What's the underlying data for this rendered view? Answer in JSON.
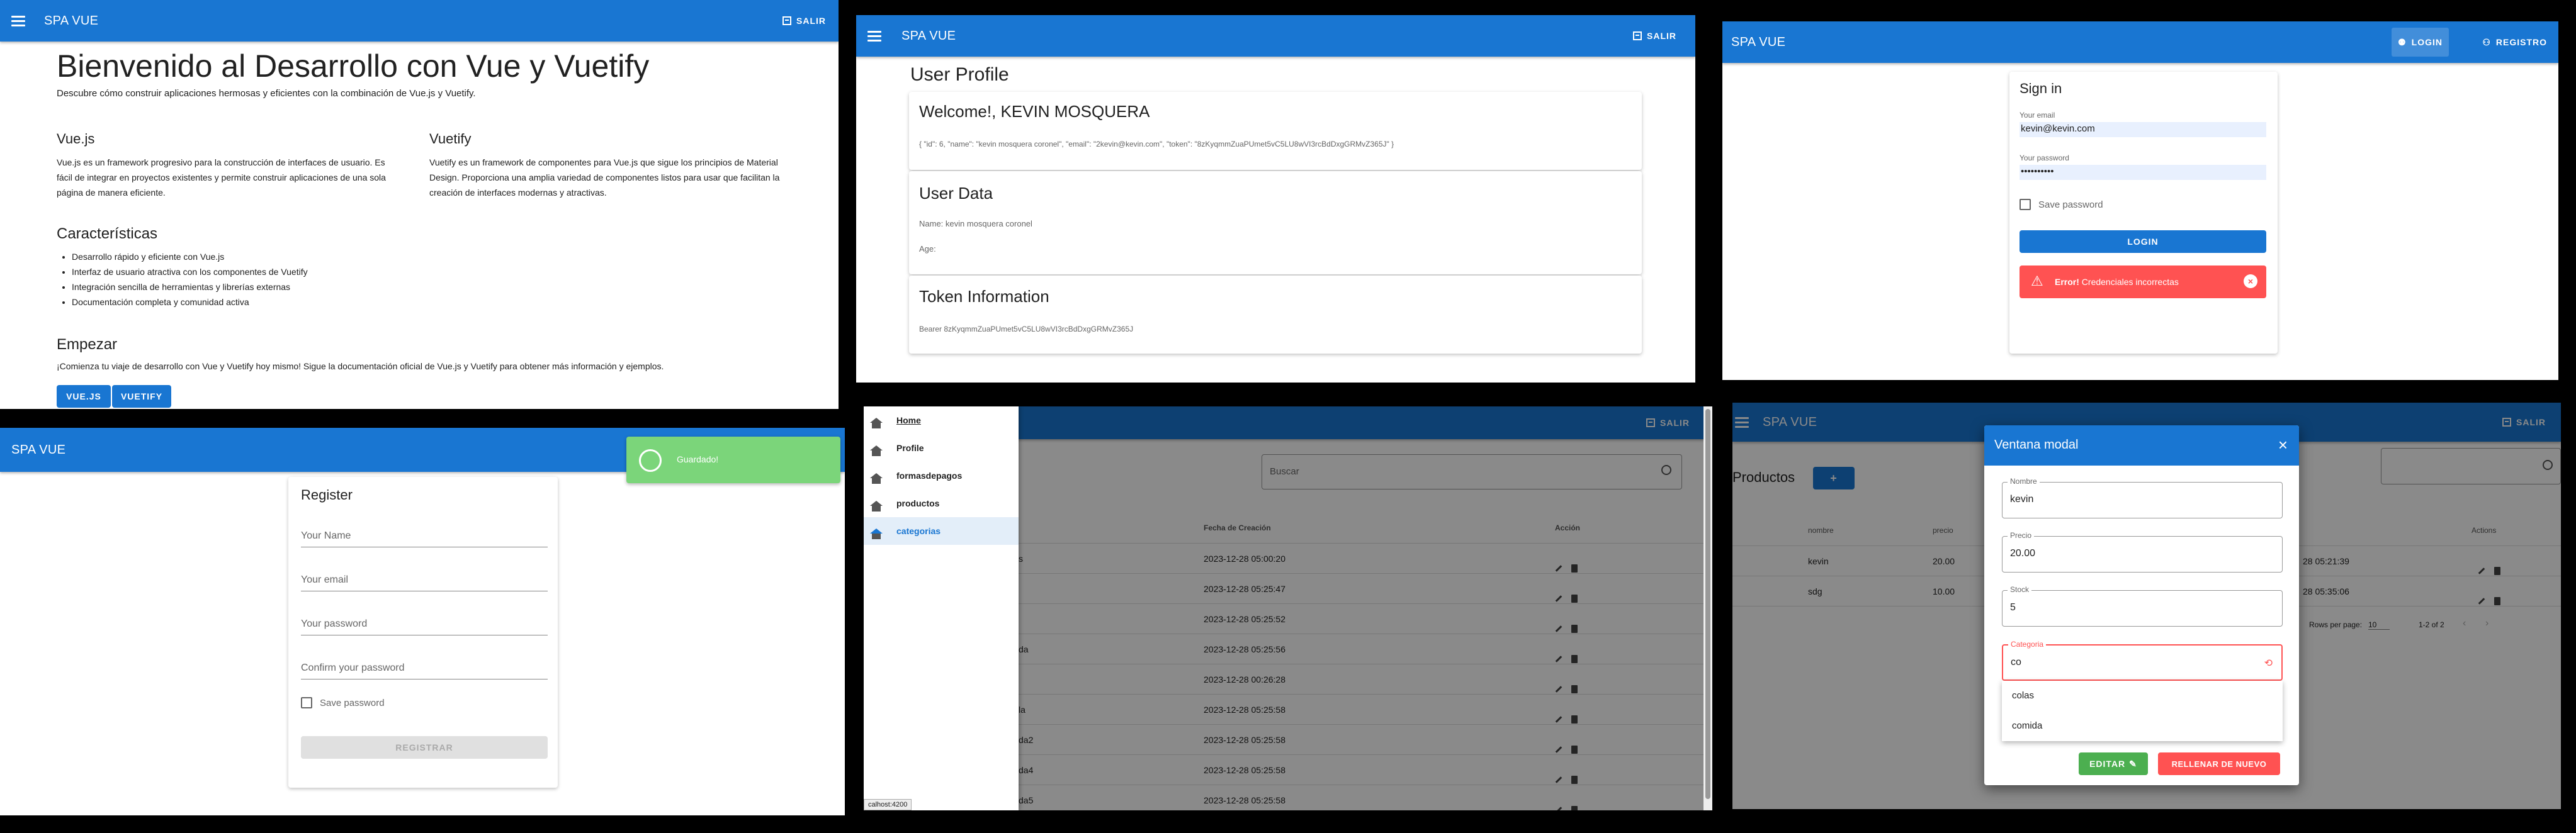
{
  "colors": {
    "primary": "#1976d2",
    "error": "#ff5252",
    "success": "#4caf50",
    "snackbar": "#7bd57a"
  },
  "p1": {
    "brand": "SPA VUE",
    "logout": "SALIR",
    "hero_title": "Bienvenido al Desarrollo con Vue y Vuetify",
    "hero_sub": "Descubre cómo construir aplicaciones hermosas y eficientes con la combinación de Vue.js y Vuetify.",
    "vue_title": "Vue.js",
    "vue_text": "Vue.js es un framework progresivo para la construcción de interfaces de usuario. Es fácil de integrar en proyectos existentes y permite construir aplicaciones de una sola página de manera eficiente.",
    "vuetify_title": "Vuetify",
    "vuetify_text": "Vuetify es un framework de componentes para Vue.js que sigue los principios de Material Design. Proporciona una amplia variedad de componentes listos para usar que facilitan la creación de interfaces modernas y atractivas.",
    "features_title": "Características",
    "features": [
      "Desarrollo rápido y eficiente con Vue.js",
      "Interfaz de usuario atractiva con los componentes de Vuetify",
      "Integración sencilla de herramientas y librerías externas",
      "Documentación completa y comunidad activa"
    ],
    "start_title": "Empezar",
    "start_text": "¡Comienza tu viaje de desarrollo con Vue y Vuetify hoy mismo! Sigue la documentación oficial de Vue.js y Vuetify para obtener más información y ejemplos.",
    "btn_vue": "VUE.JS",
    "btn_vuetify": "VUETIFY"
  },
  "p2": {
    "brand": "SPA VUE",
    "logout": "SALIR",
    "page_title": "User Profile",
    "welcome": "Welcome!, KEVIN MOSQUERA",
    "json_text": "{ \"id\": 6, \"name\": \"kevin mosquera coronel\", \"email\": \"2kevin@kevin.com\", \"token\": \"8zKyqmmZuaPUmet5vC5LU8wVI3rcBdDxgGRMvZ365J\" }",
    "user_data_title": "User Data",
    "name_line": "Name: kevin mosquera coronel",
    "age_line": "Age:",
    "token_title": "Token Information",
    "token_line": "Bearer 8zKyqmmZuaPUmet5vC5LU8wVI3rcBdDxgGRMvZ365J"
  },
  "p3": {
    "brand": "SPA VUE",
    "login": "LOGIN",
    "register": "REGISTRO",
    "title": "Sign in",
    "email_label": "Your email",
    "email_value": "kevin@kevin.com",
    "pass_label": "Your password",
    "pass_value": "••••••••••",
    "save_label": "Save password",
    "submit": "LOGIN",
    "error_bold": "Error!",
    "error_text": "Credenciales incorrectas"
  },
  "p4": {
    "brand": "SPA VUE",
    "title": "Register",
    "name_label": "Your Name",
    "email_label": "Your email",
    "pass_label": "Your password",
    "confirm_label": "Confirm your password",
    "save_label": "Save password",
    "submit": "REGISTRAR",
    "snackbar": "Guardado!"
  },
  "p5": {
    "logout": "SALIR",
    "nav": [
      "Home",
      "Profile",
      "formasdepagos",
      "productos",
      "categorias"
    ],
    "search_label": "Buscar",
    "col_date": "Fecha de Creación",
    "col_action": "Acción",
    "dates": [
      "2023-12-28 05:00:20",
      "2023-12-28 05:25:47",
      "2023-12-28 05:25:52",
      "2023-12-28 05:25:56",
      "2023-12-28 00:26:28",
      "2023-12-28 05:25:58",
      "2023-12-28 05:25:58",
      "2023-12-28 05:25:58",
      "2023-12-28 05:25:58"
    ],
    "row_suffix": [
      "s",
      "",
      "",
      "da",
      "",
      "la",
      "da2",
      "da4",
      "da5"
    ],
    "status_url": "calhost:4200"
  },
  "p6": {
    "logout": "SALIR",
    "heading": "Productos",
    "add": "+",
    "cols": [
      "nombre",
      "precio",
      "Actions"
    ],
    "rows": [
      {
        "name": "kevin",
        "price": "20.00",
        "date": "28 05:21:39"
      },
      {
        "name": "sdg",
        "price": "10.00",
        "date": "28 05:35:06"
      }
    ],
    "rows_per_page_label": "Rows per page:",
    "rows_per_page": "10",
    "page_info": "1-2 of 2",
    "modal_title": "Ventana modal",
    "f_name_label": "Nombre",
    "f_name": "kevin",
    "f_price_label": "Precio",
    "f_price": "20.00",
    "f_stock_label": "Stock",
    "f_stock": "5",
    "f_cat_label": "Categoria",
    "f_cat": "co",
    "options": [
      "colas",
      "comida"
    ],
    "edit": "EDITAR",
    "reset": "RELLENAR DE NUEVO"
  }
}
